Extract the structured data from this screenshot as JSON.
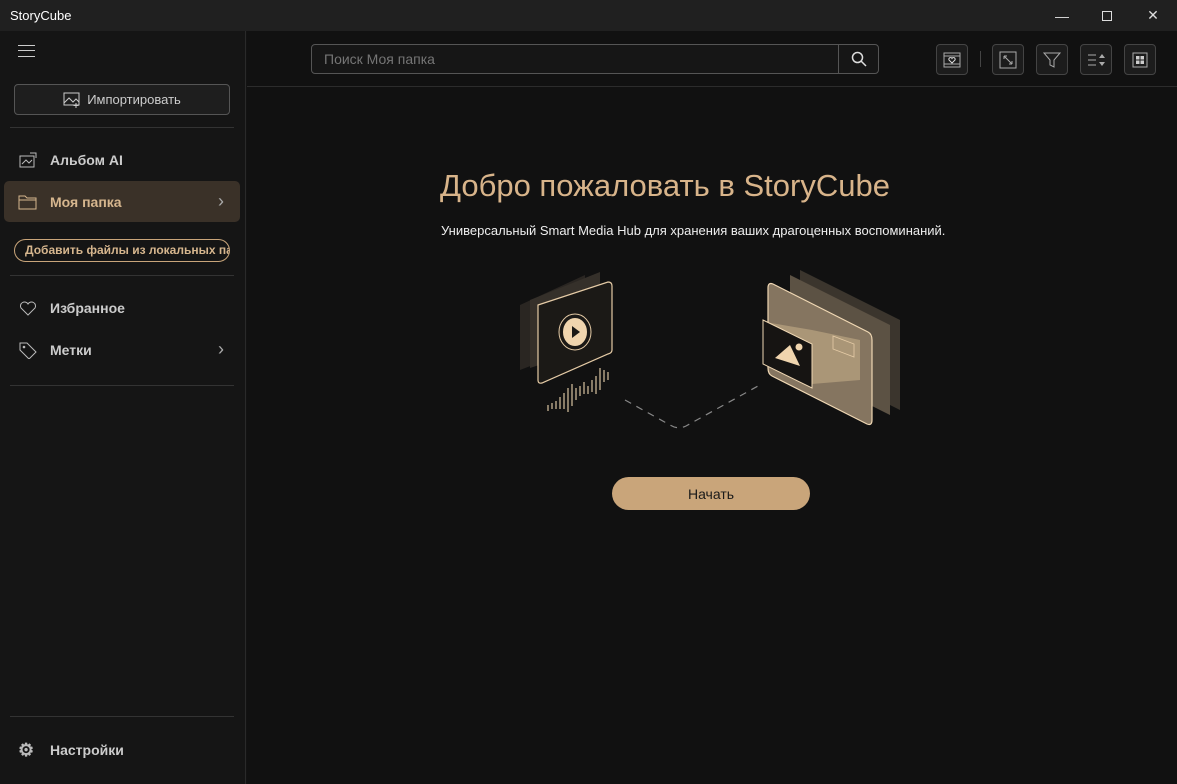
{
  "app": {
    "title": "StoryCube"
  },
  "sidebar": {
    "import_label": "Импортировать",
    "items": [
      {
        "label": "Альбом AI"
      },
      {
        "label": "Моя папка"
      },
      {
        "label": "Избранное"
      },
      {
        "label": "Метки"
      }
    ],
    "add_local_label": "Добавить файлы из локальных папок",
    "settings_label": "Настройки"
  },
  "toolbar": {
    "search_placeholder": "Поиск Моя папка"
  },
  "welcome": {
    "title": "Добро пожаловать в StoryCube",
    "subtitle": "Универсальный Smart Media Hub для хранения ваших драгоценных воспоминаний.",
    "start_label": "Начать"
  },
  "colors": {
    "accent": "#c9a57a",
    "heading": "#d8b48a"
  }
}
